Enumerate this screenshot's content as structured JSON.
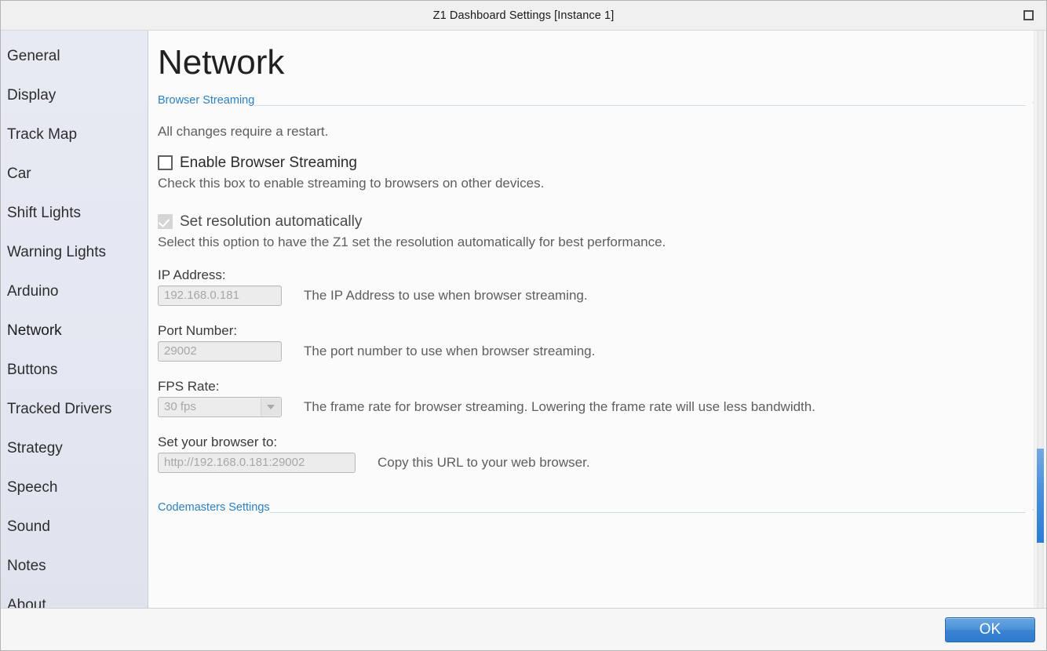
{
  "window": {
    "title": "Z1 Dashboard Settings [Instance 1]",
    "maximize_icon": "maximize-icon"
  },
  "sidebar": {
    "items": [
      {
        "label": "General"
      },
      {
        "label": "Display"
      },
      {
        "label": "Track Map"
      },
      {
        "label": "Car"
      },
      {
        "label": "Shift Lights"
      },
      {
        "label": "Warning Lights"
      },
      {
        "label": "Arduino"
      },
      {
        "label": "Network"
      },
      {
        "label": "Buttons"
      },
      {
        "label": "Tracked Drivers"
      },
      {
        "label": "Strategy"
      },
      {
        "label": "Speech"
      },
      {
        "label": "Sound"
      },
      {
        "label": "Notes"
      },
      {
        "label": "About"
      }
    ],
    "selected": "Network"
  },
  "page": {
    "title": "Network"
  },
  "sections": {
    "browser_streaming": {
      "title": "Browser Streaming",
      "collapse_icon": "chevron-up-icon",
      "restart_note": "All changes require a restart.",
      "enable": {
        "label": "Enable Browser Streaming",
        "description": "Check this box to enable streaming to browsers on other devices.",
        "checked": false
      },
      "auto_resolution": {
        "label": "Set resolution automatically",
        "description": "Select this option to have the Z1 set the resolution automatically for best performance.",
        "checked": true,
        "disabled": true
      },
      "ip_address": {
        "label": "IP Address:",
        "value": "192.168.0.181",
        "help": "The IP Address to use when browser streaming."
      },
      "port_number": {
        "label": "Port Number:",
        "value": "29002",
        "help": "The port number to use when browser streaming."
      },
      "fps_rate": {
        "label": "FPS Rate:",
        "value": "30 fps",
        "help": "The frame rate for browser streaming. Lowering the frame rate will use less bandwidth.",
        "arrow_icon": "chevron-down-icon"
      },
      "browser_url": {
        "label": "Set your browser to:",
        "value": "http://192.168.0.181:29002",
        "help": "Copy this URL to your web browser."
      }
    },
    "codemasters": {
      "title": "Codemasters Settings",
      "collapse_icon": "chevron-up-icon"
    }
  },
  "footer": {
    "ok_label": "OK"
  },
  "colors": {
    "accent_blue": "#2b7fc3",
    "button_blue": "#4a90d9",
    "sidebar_bg": "#e3e7f1"
  }
}
